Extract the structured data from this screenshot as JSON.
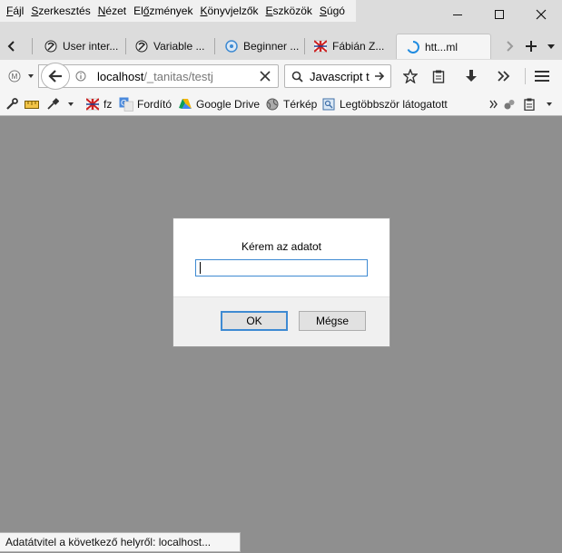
{
  "menu": [
    {
      "pre": "",
      "acc": "F",
      "post": "ájl"
    },
    {
      "pre": "",
      "acc": "S",
      "post": "zerkesztés"
    },
    {
      "pre": "",
      "acc": "N",
      "post": "ézet"
    },
    {
      "pre": "El",
      "acc": "ő",
      "post": "zmények"
    },
    {
      "pre": "",
      "acc": "K",
      "post": "önyvjelzők"
    },
    {
      "pre": "",
      "acc": "E",
      "post": "szközök"
    },
    {
      "pre": "",
      "acc": "S",
      "post": "úgó"
    }
  ],
  "tabs": [
    {
      "label": "User inter...",
      "icon": "bitbucket-icon"
    },
    {
      "label": "Variable ...",
      "icon": "bitbucket-icon"
    },
    {
      "label": "Beginner ...",
      "icon": "globe-icon"
    },
    {
      "label": "Fábián Z...",
      "icon": "union-jack-icon"
    },
    {
      "label": "htt...ml",
      "icon": "loading-spinner-icon",
      "active": true
    }
  ],
  "urlbar": {
    "host": "localhost",
    "path": "/_tanitas/testj"
  },
  "searchbar": {
    "text": "Javascript t"
  },
  "bookmarks": [
    {
      "label": "fz",
      "icon": "union-jack-icon"
    },
    {
      "label": "Fordító",
      "icon": "translate-icon"
    },
    {
      "label": "Google Drive",
      "icon": "google-drive-icon"
    },
    {
      "label": "Térkép",
      "icon": "globe-icon"
    },
    {
      "label": "Legtöbbször látogatott",
      "icon": "bookmark-page-icon"
    }
  ],
  "dialog": {
    "message": "Kérem az adatot",
    "input_value": "",
    "ok_label": "OK",
    "cancel_label": "Mégse"
  },
  "status": {
    "text": "Adatátvitel a következő helyről: localhost..."
  },
  "colors": {
    "accent": "#3e8ad2",
    "content_bg": "#8f8f8f",
    "chrome": "#f5f5f5"
  }
}
